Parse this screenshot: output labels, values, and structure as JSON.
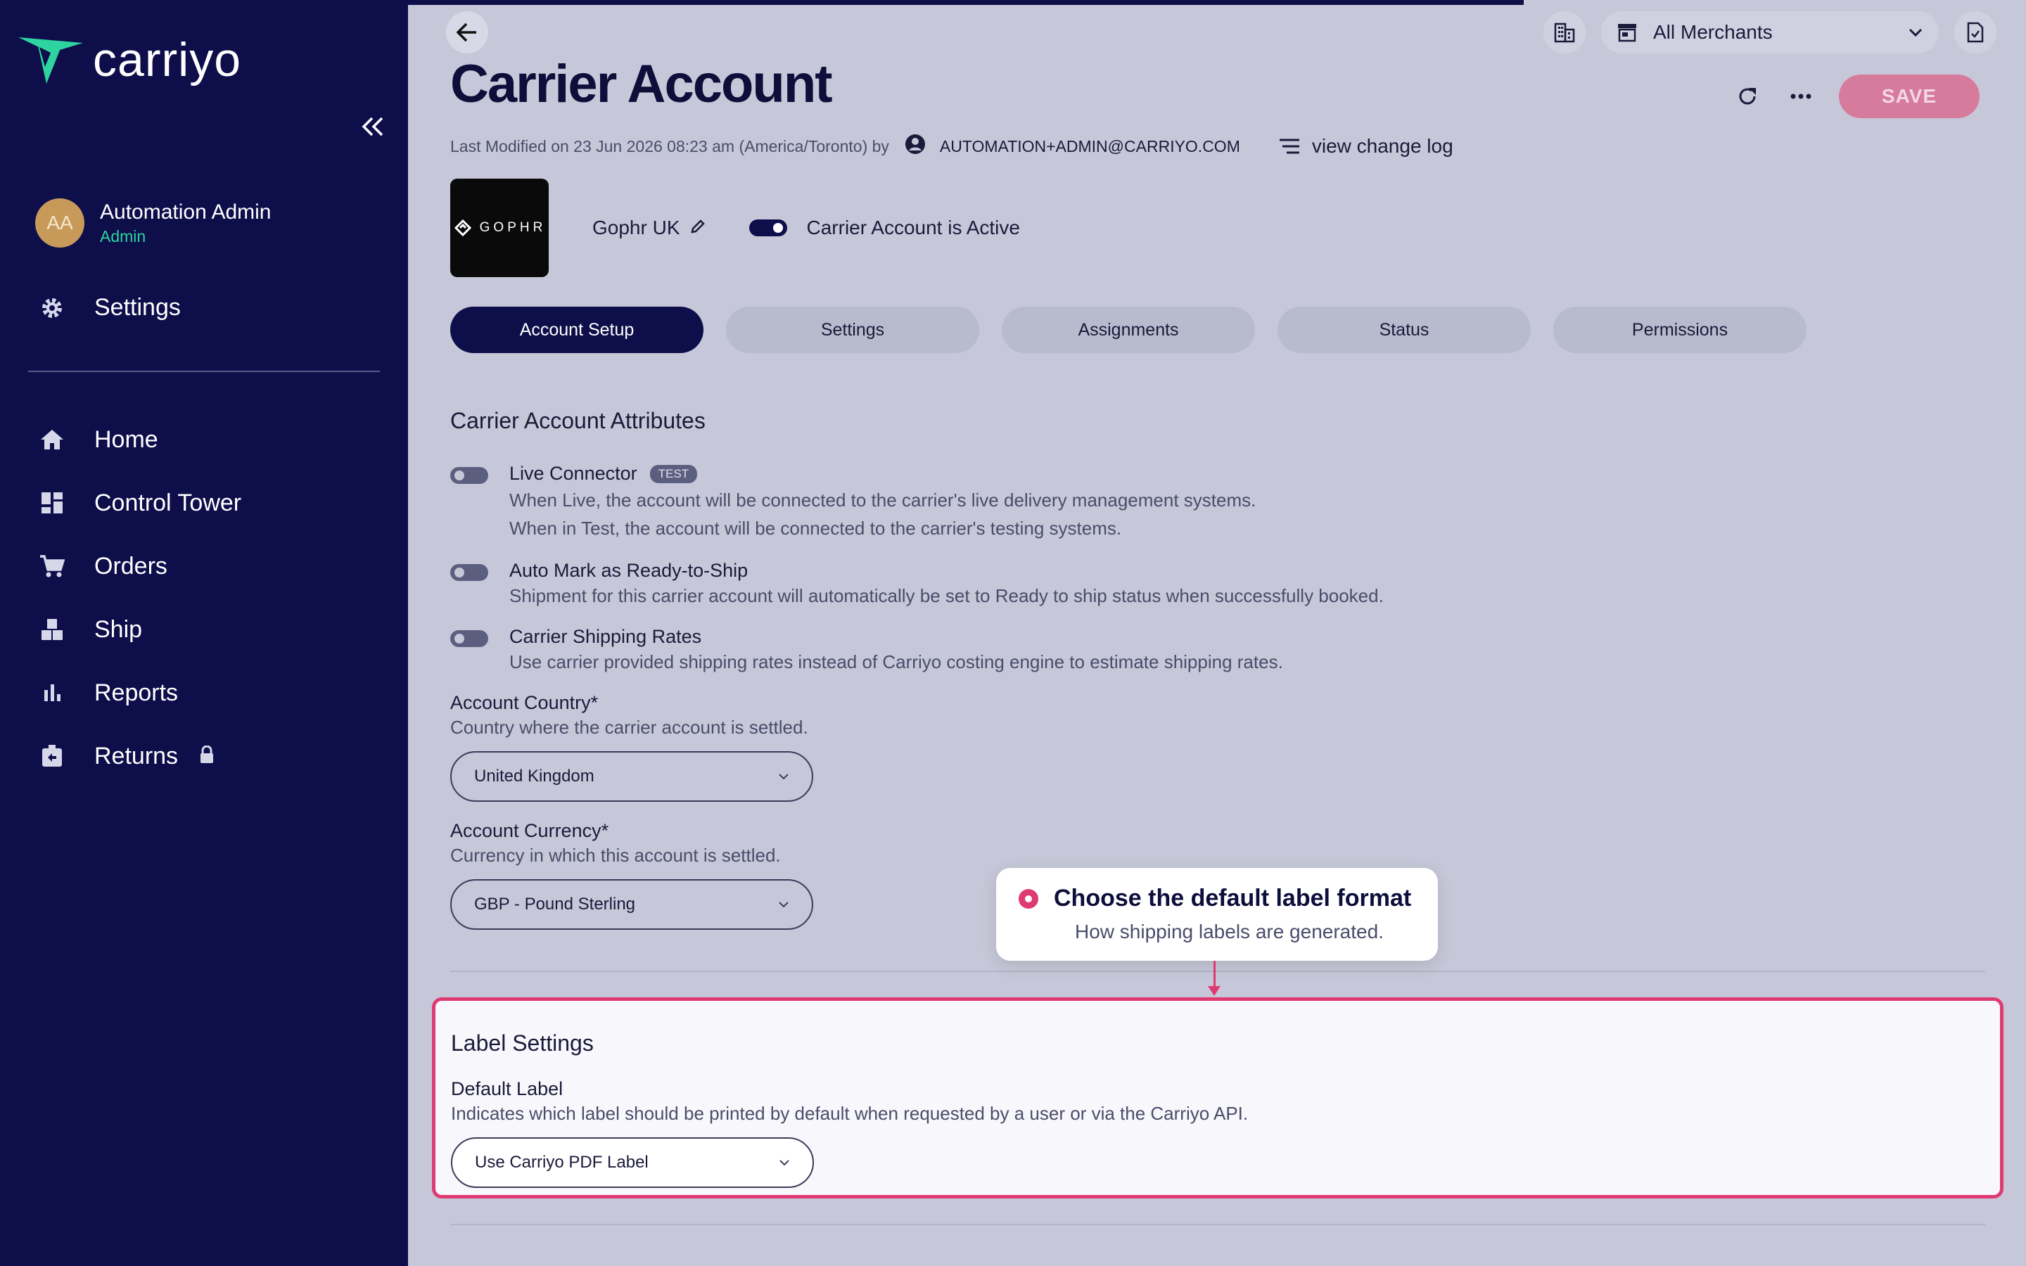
{
  "sidebar": {
    "logo_text": "carriyo",
    "user": {
      "initials": "AA",
      "name": "Automation Admin",
      "role": "Admin"
    },
    "settings_label": "Settings",
    "items": [
      {
        "label": "Home",
        "icon": "home-icon"
      },
      {
        "label": "Control Tower",
        "icon": "dashboard-icon"
      },
      {
        "label": "Orders",
        "icon": "cart-icon"
      },
      {
        "label": "Ship",
        "icon": "boxes-icon"
      },
      {
        "label": "Reports",
        "icon": "bar-chart-icon"
      },
      {
        "label": "Returns",
        "icon": "return-box-icon"
      }
    ]
  },
  "header": {
    "title": "Carrier Account",
    "merchant_select": "All Merchants",
    "save_label": "SAVE",
    "meta_text": "Last Modified on 23 Jun 2026 08:23 am (America/Toronto) by",
    "meta_email": "AUTOMATION+ADMIN@CARRIYO.COM",
    "changelog_label": "view change log"
  },
  "carrier": {
    "logo_text": "GOPHR",
    "name": "Gophr UK",
    "active_label": "Carrier Account is Active",
    "active": true
  },
  "tabs": [
    {
      "label": "Account Setup",
      "active": true
    },
    {
      "label": "Settings",
      "active": false
    },
    {
      "label": "Assignments",
      "active": false
    },
    {
      "label": "Status",
      "active": false
    },
    {
      "label": "Permissions",
      "active": false
    }
  ],
  "attributes": {
    "title": "Carrier Account Attributes",
    "live_connector": {
      "name": "Live Connector",
      "badge": "TEST",
      "desc1": "When Live, the account will be connected to the carrier's live delivery management systems.",
      "desc2": "When in Test, the account will be connected to the carrier's testing systems."
    },
    "auto_mark": {
      "name": "Auto Mark as Ready-to-Ship",
      "desc": "Shipment for this carrier account will automatically be set to Ready to ship status when successfully booked."
    },
    "shipping_rates": {
      "name": "Carrier Shipping Rates",
      "desc": "Use carrier provided shipping rates instead of Carriyo costing engine to estimate shipping rates."
    }
  },
  "account_country": {
    "label": "Account Country*",
    "desc": "Country where the carrier account is settled.",
    "value": "United Kingdom"
  },
  "account_currency": {
    "label": "Account Currency*",
    "desc": "Currency in which this account is settled.",
    "value": "GBP - Pound Sterling"
  },
  "label_settings": {
    "title": "Label Settings",
    "default_label": {
      "label": "Default Label",
      "desc": "Indicates which label should be printed by default when requested by a user or via the Carriyo API.",
      "value": "Use Carriyo PDF Label"
    }
  },
  "tooltip": {
    "title": "Choose the default label format",
    "subtitle": "How shipping labels are generated."
  },
  "colors": {
    "sidebar_bg": "#0d0e4a",
    "accent": "#e03a72",
    "brand_green": "#2fd3a0"
  }
}
